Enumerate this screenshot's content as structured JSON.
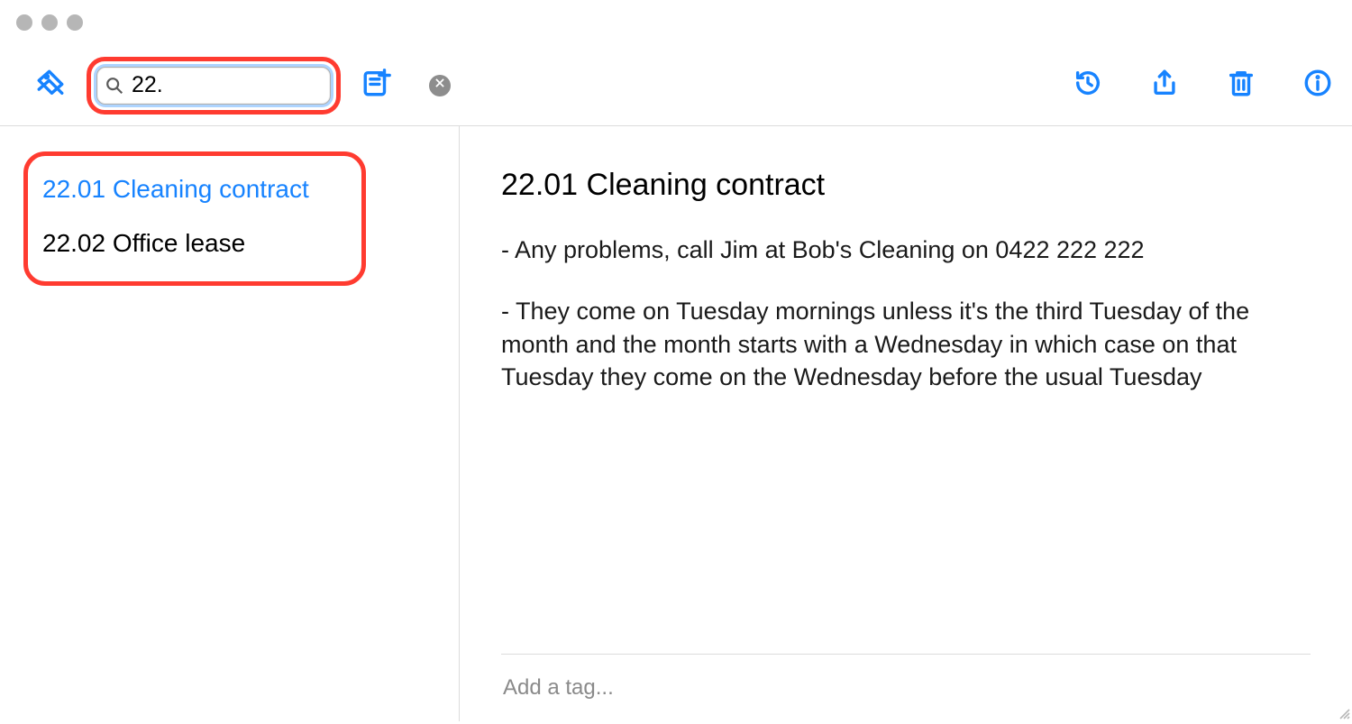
{
  "search": {
    "value": "22."
  },
  "sidebar": {
    "results": [
      {
        "label": "22.01 Cleaning contract",
        "selected": true
      },
      {
        "label": "22.02 Office lease",
        "selected": false
      }
    ]
  },
  "note": {
    "title": "22.01 Cleaning contract",
    "lines": [
      "- Any problems, call Jim at Bob's Cleaning on 0422 222 222",
      "- They come on Tuesday mornings unless it's the third Tuesday of the month and the month starts with a Wednesday in which case on that Tuesday they come on the Wednesday before the usual Tuesday"
    ]
  },
  "tagbar": {
    "placeholder": "Add a tag..."
  }
}
